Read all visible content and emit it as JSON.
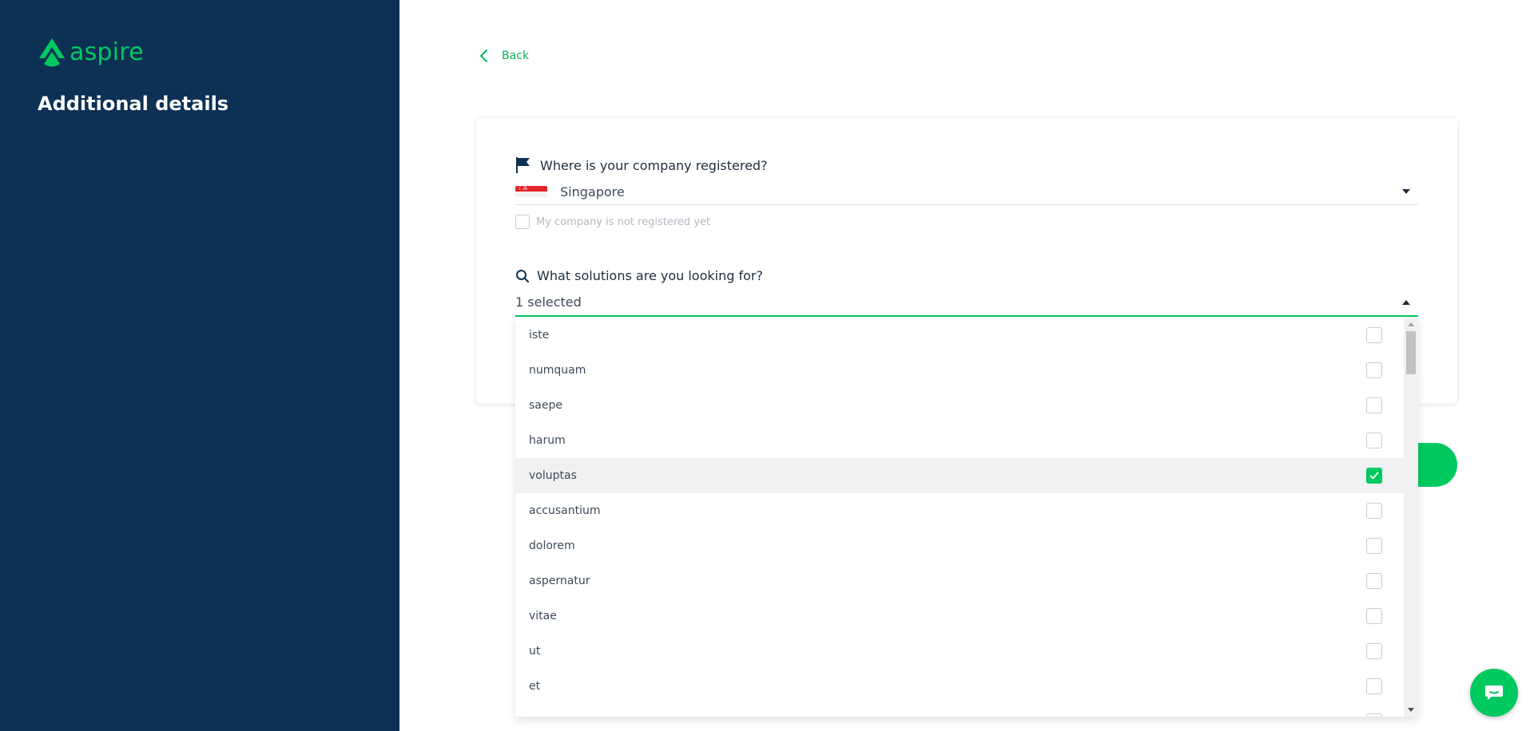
{
  "sidebar": {
    "logo_text": "aspire",
    "title": "Additional details"
  },
  "nav": {
    "back_label": "Back"
  },
  "form": {
    "country_question": "Where is your company registered?",
    "country_value": "Singapore",
    "not_registered_label": "My company is not registered yet",
    "solutions_question": "What solutions are you looking for?",
    "solutions_value": "1 selected"
  },
  "dropdown": {
    "options": [
      {
        "label": "iste",
        "checked": false
      },
      {
        "label": "numquam",
        "checked": false
      },
      {
        "label": "saepe",
        "checked": false
      },
      {
        "label": "harum",
        "checked": false
      },
      {
        "label": "voluptas",
        "checked": true
      },
      {
        "label": "accusantium",
        "checked": false
      },
      {
        "label": "dolorem",
        "checked": false
      },
      {
        "label": "aspernatur",
        "checked": false
      },
      {
        "label": "vitae",
        "checked": false
      },
      {
        "label": "ut",
        "checked": false
      },
      {
        "label": "et",
        "checked": false
      }
    ]
  },
  "colors": {
    "sidebar_bg": "#0d3055",
    "accent": "#00c95f",
    "text": "#1f2d3d"
  },
  "icons": {
    "back": "chevron-left-icon",
    "country": "flag-icon",
    "solutions": "search-icon",
    "chat": "chat-icon"
  }
}
